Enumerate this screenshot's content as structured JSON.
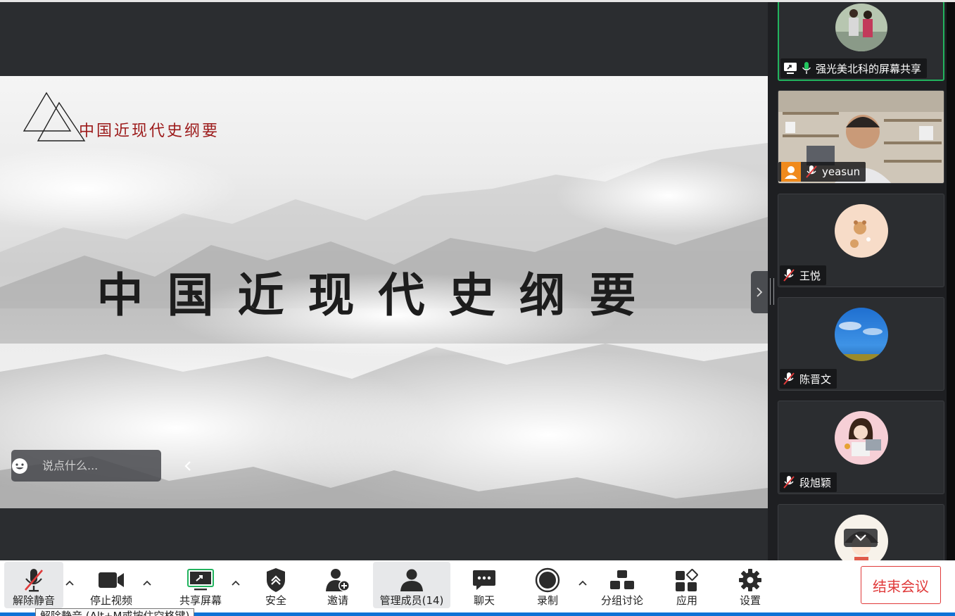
{
  "slide": {
    "logo_text": "中国近现代史纲要",
    "title": "中国近现代史纲要"
  },
  "chat": {
    "placeholder": "说点什么..."
  },
  "participants": [
    {
      "name": "强光美北科的屏幕共享",
      "muted": false,
      "sharing": true,
      "avatar": "photo-icon"
    },
    {
      "name": "yeasun",
      "muted": true,
      "host": true,
      "avatar": "video-feed"
    },
    {
      "name": "王悦",
      "muted": true,
      "avatar": "bear-avatar"
    },
    {
      "name": "陈晋文",
      "muted": true,
      "avatar": "sky-avatar"
    },
    {
      "name": "段旭颖",
      "muted": true,
      "avatar": "illustration-avatar"
    }
  ],
  "toolbar": {
    "unmute": "解除静音",
    "stop_video": "停止视频",
    "share_screen": "共享屏幕",
    "security": "安全",
    "invite": "邀请",
    "manage_members": "管理成员(14)",
    "chat": "聊天",
    "record": "录制",
    "breakout": "分组讨论",
    "apps": "应用",
    "settings": "设置",
    "end_meeting": "结束会议"
  },
  "tooltip": {
    "text": "解除静音 (Alt+M或按住空格键)"
  },
  "colors": {
    "accent_green": "#22b35e",
    "end_red": "#e03a3a",
    "toolbar_accent": "#0e72d6"
  }
}
